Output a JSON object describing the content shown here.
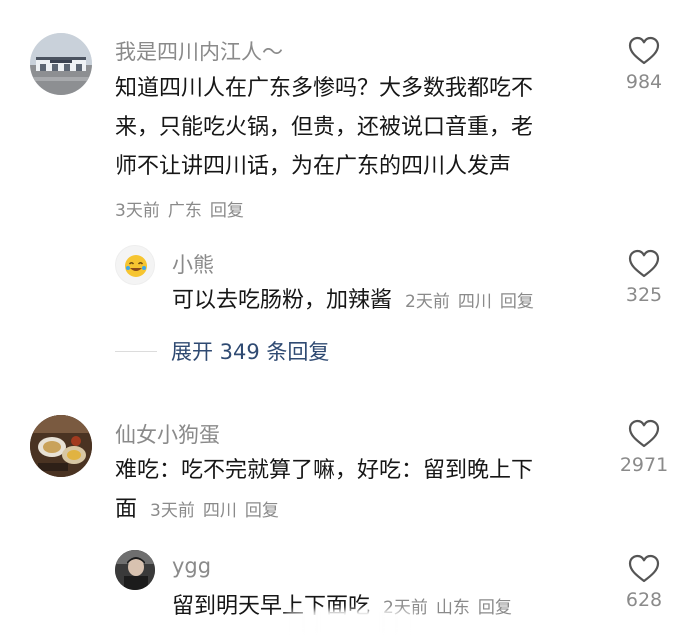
{
  "comments": [
    {
      "username": "我是四川内江人～",
      "text_lines": [
        "知道四川人在广东多惨吗？大多数我都吃不",
        "来，只能吃火锅，但贵，还被说口音重，老",
        "师不让讲四川话，为在广东的四川人发声"
      ],
      "time": "3天前",
      "location": "广东",
      "reply_label": "回复",
      "likes": "984",
      "avatar_icon": "station-photo-avatar",
      "replies": [
        {
          "username": "小熊",
          "text": "可以去吃肠粉，加辣酱",
          "time": "2天前",
          "location": "四川",
          "reply_label": "回复",
          "likes": "325",
          "avatar_icon": "smiley-emoji-avatar"
        }
      ],
      "expand_label": "展开 349 条回复"
    },
    {
      "username": "仙女小狗蛋",
      "text_lines": [
        "难吃：吃不完就算了嘛，好吃：留到晚上下",
        "面"
      ],
      "time": "3天前",
      "location": "四川",
      "reply_label": "回复",
      "likes": "2971",
      "avatar_icon": "food-photo-avatar",
      "replies": [
        {
          "username": "ygg",
          "text": "留到明天早上下面吃",
          "time": "2天前",
          "location": "山东",
          "reply_label": "回复",
          "likes": "628",
          "avatar_icon": "person-photo-avatar"
        }
      ]
    }
  ],
  "colors": {
    "secondary_text": "#8a8a8a",
    "expand_link": "#2f4a72",
    "heart_outline": "#555555"
  }
}
